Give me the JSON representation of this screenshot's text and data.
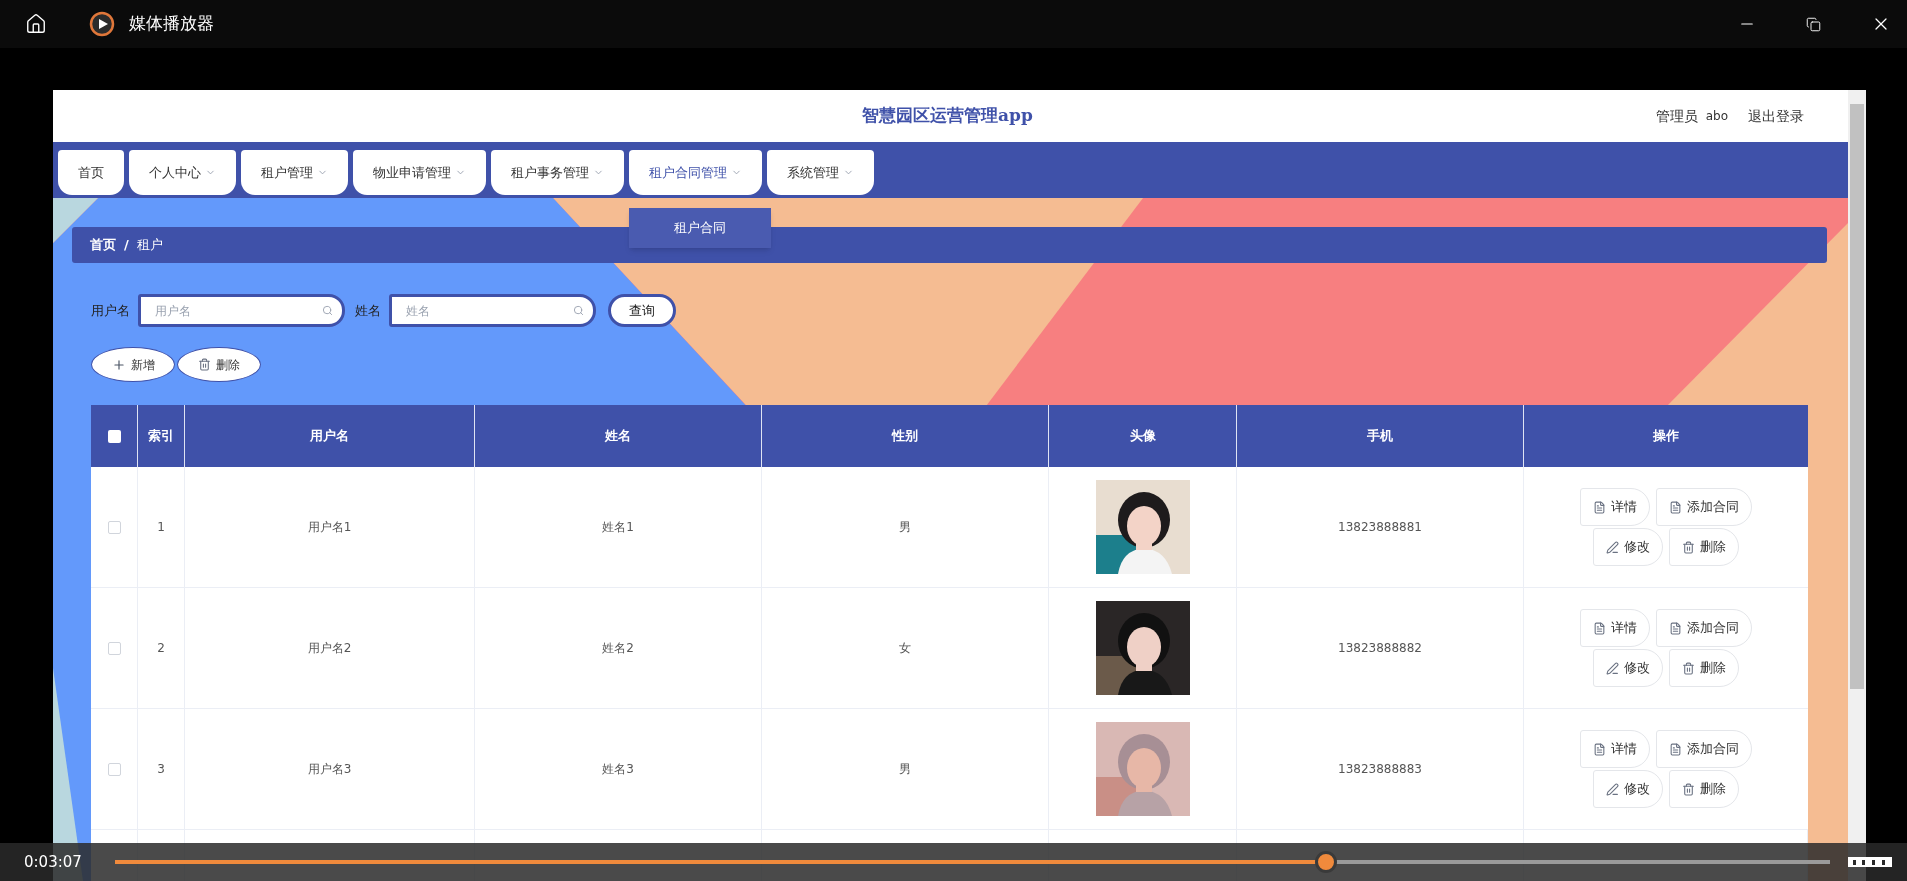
{
  "player": {
    "title": "媒体播放器",
    "time": "0:03:07",
    "progress": {
      "level": 0.706
    }
  },
  "app": {
    "title": "智慧园区运营管理app",
    "user_role": "管理员",
    "username": "abo",
    "logout": "退出登录",
    "nav": [
      {
        "label": "首页",
        "has_menu": false,
        "expanded": false
      },
      {
        "label": "个人中心",
        "has_menu": true,
        "expanded": false
      },
      {
        "label": "租户管理",
        "has_menu": true,
        "expanded": false
      },
      {
        "label": "物业申请管理",
        "has_menu": true,
        "expanded": false
      },
      {
        "label": "租户事务管理",
        "has_menu": true,
        "expanded": false
      },
      {
        "label": "租户合同管理",
        "has_menu": true,
        "expanded": true,
        "menu": [
          "租户合同"
        ]
      },
      {
        "label": "系统管理",
        "has_menu": true,
        "expanded": false
      }
    ],
    "breadcrumb": [
      "首页",
      "租户"
    ],
    "breadcrumb_separator": "/",
    "search": {
      "fields": [
        {
          "label": "用户名",
          "placeholder": "用户名"
        },
        {
          "label": "姓名",
          "placeholder": "姓名"
        }
      ],
      "button": "查询"
    },
    "actions": [
      {
        "kind": "add",
        "label": "新增"
      },
      {
        "kind": "delete",
        "label": "删除"
      }
    ],
    "table": {
      "header_checked": false,
      "columns": [
        "索引",
        "用户名",
        "姓名",
        "性别",
        "头像",
        "手机",
        "操作"
      ],
      "rows": [
        {
          "checked": false,
          "index": "1",
          "username": "用户名1",
          "name": "姓名1",
          "gender": "男",
          "phone": "13823888881",
          "actions": [
            {
              "kind": "detail",
              "label": "详情"
            },
            {
              "kind": "contract",
              "label": "添加合同"
            },
            {
              "kind": "edit",
              "label": "修改"
            },
            {
              "kind": "delete",
              "label": "删除"
            }
          ]
        },
        {
          "checked": false,
          "index": "2",
          "username": "用户名2",
          "name": "姓名2",
          "gender": "女",
          "phone": "13823888882",
          "actions": [
            {
              "kind": "detail",
              "label": "详情"
            },
            {
              "kind": "contract",
              "label": "添加合同"
            },
            {
              "kind": "edit",
              "label": "修改"
            },
            {
              "kind": "delete",
              "label": "删除"
            }
          ]
        },
        {
          "checked": false,
          "index": "3",
          "username": "用户名3",
          "name": "姓名3",
          "gender": "男",
          "phone": "13823888883",
          "actions": [
            {
              "kind": "detail",
              "label": "详情"
            },
            {
              "kind": "contract",
              "label": "添加合同"
            },
            {
              "kind": "edit",
              "label": "修改"
            },
            {
              "kind": "delete",
              "label": "删除"
            }
          ]
        }
      ]
    }
  }
}
